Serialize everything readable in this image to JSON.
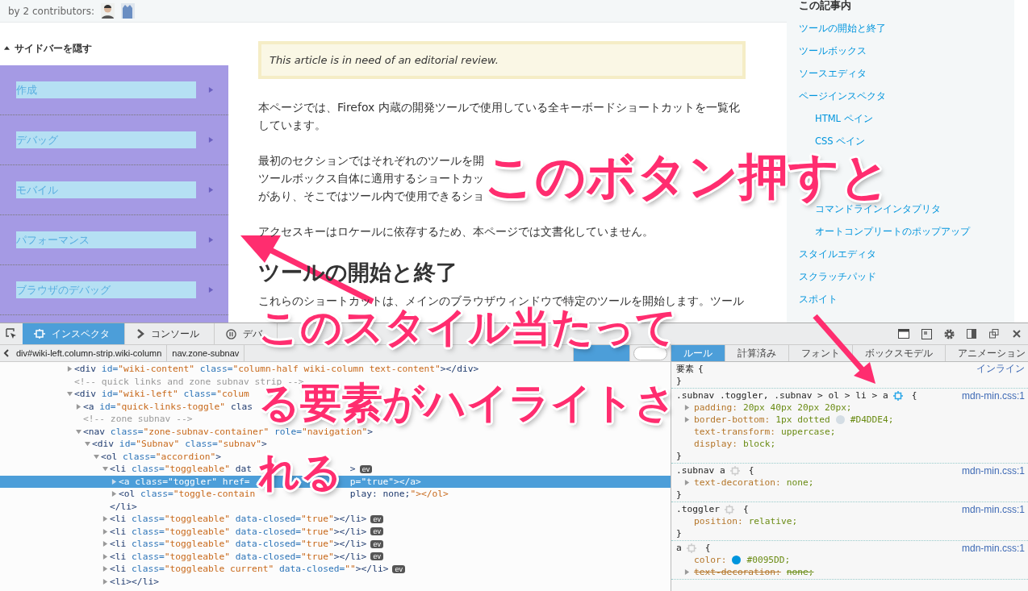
{
  "page": {
    "contributors": "by 2 contributors:",
    "sidebar": {
      "toggle": "サイドバーを隠す",
      "items": [
        {
          "label": "作成"
        },
        {
          "label": "デバッグ"
        },
        {
          "label": "モバイル"
        },
        {
          "label": "パフォーマンス"
        },
        {
          "label": "ブラウザのデバッグ"
        }
      ]
    },
    "notice": "This article is in need of an editorial review.",
    "paragraphs": [
      {
        "kind": "text",
        "text": "本ページでは、Firefox 内蔵の開発ツールで使用している全キーボードショートカットを一覧化しています。"
      },
      {
        "kind": "lines",
        "lines": [
          [
            "最初のセクションではそれぞれのツールを開"
          ],
          [
            "ツールボックス自体に適用するショートカッ"
          ],
          [
            "があり、そこではツール内で使用できるショ"
          ]
        ]
      },
      {
        "kind": "text",
        "text": "アクセスキーはロケールに依存するため、本ページでは文書化していません。"
      }
    ],
    "heading": "ツールの開始と終了",
    "intro": "これらのショートカットは、メインのブラウザウィンドウで特定のツールを開始します。ツール",
    "toc": {
      "title": "この記事内",
      "items": [
        {
          "kind": "link",
          "label": "ツールの開始と終了"
        },
        {
          "kind": "link",
          "label": "ツールボックス"
        },
        {
          "kind": "link",
          "label": "ソースエディタ"
        },
        {
          "kind": "link",
          "label": "ページインスペクタ",
          "children": [
            {
              "label": "HTML ペイン"
            },
            {
              "label": "CSS ペイン"
            }
          ]
        },
        {
          "kind": "covered"
        },
        {
          "kind": "covered",
          "children": [
            {
              "label": "コマンドラインインタプリタ"
            },
            {
              "label": "オートコンプリートのポップアップ"
            }
          ]
        },
        {
          "kind": "link",
          "label": "スタイルエディタ"
        },
        {
          "kind": "link",
          "label": "スクラッチパッド"
        },
        {
          "kind": "link",
          "label": "スポイト"
        }
      ]
    }
  },
  "devtools": {
    "tabs": [
      {
        "label": "インスペクタ",
        "kind": "inspector",
        "selected": true
      },
      {
        "label": "コンソール",
        "kind": "console",
        "selected": false
      },
      {
        "label": "デバ",
        "kind": "debugger",
        "selected": false
      }
    ],
    "breadcrumbs": [
      {
        "label": "div#wiki-left.column-strip.wiki-column",
        "selected": false
      },
      {
        "label": "nav.zone-subnav",
        "selected": false
      },
      {
        "selected": false
      },
      {
        "selected": true
      }
    ],
    "tree": [
      {
        "kind": "element",
        "text": "<div id=\"wiki-content\" class=\"column-half wiki-column text-content\"></div>",
        "expanded": false,
        "selected": false
      },
      {
        "kind": "comment",
        "text": "<!-- quick links and zone subnav strip -->",
        "selected": false
      },
      {
        "kind": "element",
        "text": "<div id=\"wiki-left\" class=\"colum",
        "expanded": true,
        "selected": false,
        "children": [
          {
            "kind": "element",
            "text": "<a id=\"quick-links-toggle\" clas",
            "expanded": false,
            "selected": false
          },
          {
            "kind": "comment",
            "text": "<!-- zone subnav -->",
            "selected": false
          },
          {
            "kind": "element",
            "text": "<nav class=\"zone-subnav-container\" role=\"navigation\">",
            "expanded": true,
            "selected": false,
            "children": [
              {
                "kind": "element",
                "text": "<div id=\"Subnav\" class=\"subnav\">",
                "expanded": true,
                "selected": false,
                "children": [
                  {
                    "kind": "element",
                    "text": "<ol class=\"accordion\">",
                    "expanded": true,
                    "selected": false,
                    "children": [
                      {
                        "kind": "element",
                        "text": "<li class=\"toggleable\" dat",
                        "tail": ">",
                        "expanded": true,
                        "selected": false,
                        "badge": "ev",
                        "close": "</li>",
                        "children": [
                          {
                            "kind": "element",
                            "text": "<a class=\"toggler\" href=",
                            "tail": "p=\"true\"></a>",
                            "expanded": false,
                            "selected": true
                          },
                          {
                            "kind": "element",
                            "text": "<ol class=\"toggle-contain",
                            "tail": "play: none;\"></ol>",
                            "expanded": false,
                            "selected": false
                          }
                        ]
                      },
                      {
                        "kind": "element",
                        "text": "<li class=\"toggleable\" data-closed=\"true\"></li>",
                        "expanded": false,
                        "selected": false,
                        "badge": "ev"
                      },
                      {
                        "kind": "element",
                        "text": "<li class=\"toggleable\" data-closed=\"true\"></li>",
                        "expanded": false,
                        "selected": false,
                        "badge": "ev"
                      },
                      {
                        "kind": "element",
                        "text": "<li class=\"toggleable\" data-closed=\"true\"></li>",
                        "expanded": false,
                        "selected": false,
                        "badge": "ev"
                      },
                      {
                        "kind": "element",
                        "text": "<li class=\"toggleable\" data-closed=\"true\"></li>",
                        "expanded": false,
                        "selected": false,
                        "badge": "ev"
                      },
                      {
                        "kind": "element",
                        "text": "<li class=\"toggleable current\" data-closed=\"\"></li>",
                        "expanded": false,
                        "selected": false,
                        "badge": "ev"
                      },
                      {
                        "kind": "element",
                        "text": "<li></li>",
                        "expanded": false,
                        "selected": false
                      }
                    ]
                  }
                ]
              }
            ]
          }
        ]
      }
    ],
    "rule_tabs": [
      {
        "label": "ルール",
        "selected": true
      },
      {
        "label": "計算済み",
        "selected": false
      },
      {
        "label": "フォント",
        "selected": false
      },
      {
        "label": "ボックスモデル",
        "selected": false
      },
      {
        "label": "アニメーション",
        "selected": false
      }
    ],
    "rules": [
      {
        "selector": "要素",
        "source": "インライン",
        "open": "{",
        "close": "}"
      },
      {
        "selector": ".subnav .toggler, .subnav > ol > li > a",
        "highlighter": true,
        "open": "{",
        "close": "}",
        "source": "mdn-min.css:1",
        "declarations": [
          {
            "property": "padding:",
            "value": "20px 40px 20px 20px;",
            "expandable": true,
            "overridden": false
          },
          {
            "property": "border-bottom:",
            "value": "1px dotted",
            "color": "#d4dde4",
            "color_value": "#D4DDE4;",
            "expandable": true,
            "overridden": false
          },
          {
            "property": "text-transform:",
            "value": "uppercase;",
            "expandable": false,
            "overridden": false
          },
          {
            "property": "display:",
            "value": "block;",
            "expandable": false,
            "overridden": false
          }
        ]
      },
      {
        "selector": ".subnav a",
        "highlighter": false,
        "open": "{",
        "close": "}",
        "source": "mdn-min.css:1",
        "declarations": [
          {
            "property": "text-decoration:",
            "value": "none;",
            "expandable": true,
            "overridden": false
          }
        ]
      },
      {
        "selector": ".toggler",
        "highlighter": false,
        "open": "{",
        "close": "}",
        "source": "mdn-min.css:1",
        "declarations": [
          {
            "property": "position:",
            "value": "relative;",
            "expandable": false,
            "overridden": false
          }
        ]
      },
      {
        "selector": "a",
        "highlighter": false,
        "open": "{",
        "source": "mdn-min.css:1",
        "declarations": [
          {
            "property": "color:",
            "color": "#0095dd",
            "color_value": "#0095DD;",
            "expandable": false,
            "overridden": false
          },
          {
            "property": "text-decoration:",
            "value": "none;",
            "expandable": true,
            "overridden": true
          }
        ]
      }
    ]
  },
  "annotations": [
    {
      "kind": "top",
      "lines": [
        "このボタン押すと"
      ]
    },
    {
      "kind": "bottom",
      "lines": [
        "このスタイル当たって",
        "る要素がハイライトさ",
        "れる"
      ]
    }
  ]
}
